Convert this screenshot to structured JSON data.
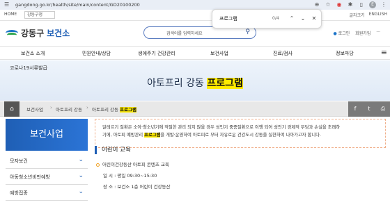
{
  "browser": {
    "url": "gangdong.go.kr/health/site/main/content/GD20100200",
    "avatar": "E"
  },
  "findbar": {
    "query": "프로그램",
    "count": "0/4"
  },
  "util": {
    "home": "HOME",
    "select": "강동구청",
    "links": [
      "글자크기",
      "ENGLISH"
    ]
  },
  "header": {
    "logo_prefix": "강동구",
    "logo_suffix": "보건소",
    "search_placeholder": "검색어를 입력하세요",
    "links": [
      "로그인",
      "회원가입"
    ],
    "sitemap": "···"
  },
  "nav": {
    "items": [
      "보건소 소개",
      "민원안내/상담",
      "생애주기 건강관리",
      "보건사업",
      "진료/검사",
      "정보마당"
    ]
  },
  "hero": {
    "covid": "코로나19서류발급",
    "title_plain": "아토프리 강동 ",
    "title_highlight": "프로그램"
  },
  "breadcrumb": {
    "items": [
      "보건사업",
      "아토프리 강동",
      "아토프리 강동 "
    ],
    "last_highlight": "프로그램"
  },
  "sidebar": {
    "title": "보건사업",
    "items": [
      "모자보건",
      "아동청소년비만예방",
      "예방접종"
    ]
  },
  "notice": {
    "line1": "알레르기 질환은 소아·청소년기에 적절한 관리 되지 않을 경우 성인기 중증질환으로 이행 되어 성인기 경제적 부담과 손실을 초래하",
    "line2_a": "기에, 아토피 예방관리 ",
    "line2_hl": "프로그램",
    "line2_b": "을 개발·운영하여 아토피로 부터 자유로운 건강도시 강동을 실현하여 나아가고자 합니다."
  },
  "education": {
    "heading": "어린이 교육",
    "program": "어린이건강동산 아토피 콘텐츠 교육",
    "time": "일 시 : 평일 09:30~15:30",
    "place": "장 소 : 보건소 1층 어린이 건강동산"
  },
  "colors": {
    "brand_blue": "#1f5fb5",
    "highlight": "#ffeb00"
  }
}
